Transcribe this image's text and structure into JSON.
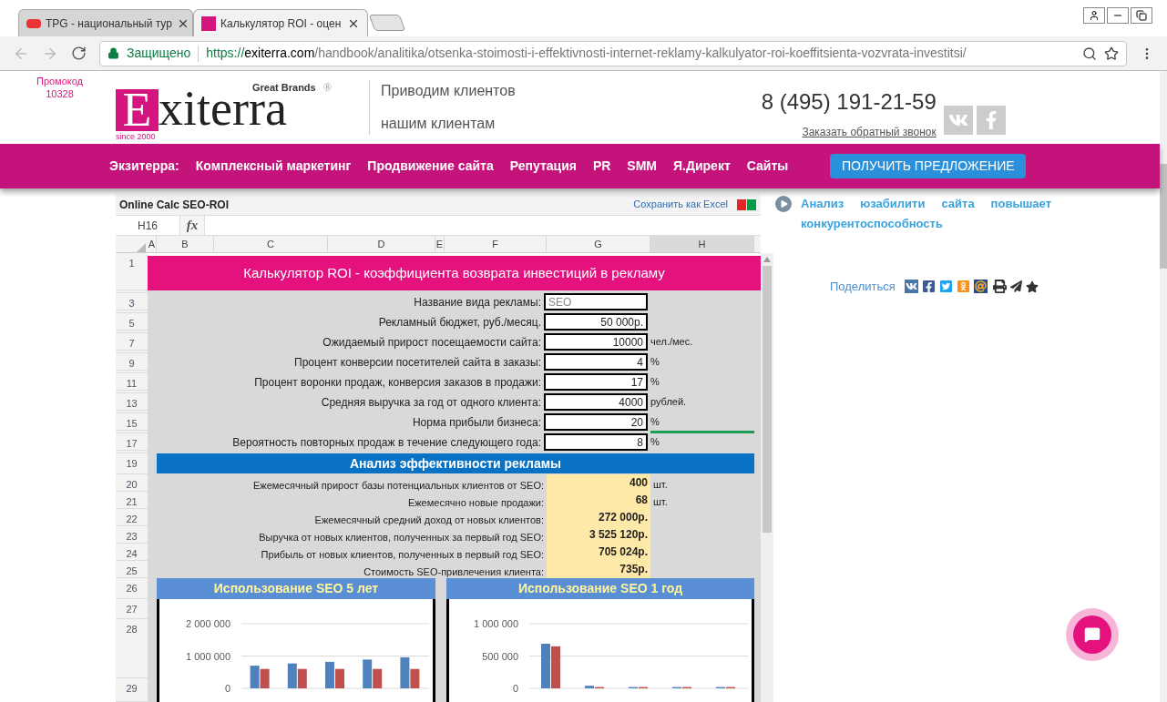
{
  "browser": {
    "tabs": [
      {
        "title": "TPG - национальный тур",
        "selected": false
      },
      {
        "title": "Калькулятор ROI - оцен",
        "selected": true
      }
    ],
    "address": {
      "secure_label": "Защищено",
      "scheme": "https://",
      "host": "exiterra.com",
      "path": "/handbook/analitika/otsenka-stoimosti-i-effektivnosti-internet-reklamy-kalkulyator-roi-koeffitsienta-vozvrata-investitsi/"
    }
  },
  "header": {
    "promo": [
      "Промокод",
      "10328"
    ],
    "logo": {
      "initial": "E",
      "rest": "xiterra",
      "brands": "Great Brands",
      "mark": "®",
      "since": "since 2000"
    },
    "slogan": [
      "Приводим клиентов",
      "нашим клиентам"
    ],
    "phone": "8 (495) 191-21-59",
    "callback": "Заказать обратный звонок"
  },
  "nav": {
    "label": "Экзитерра:",
    "items": [
      "Комплексный маркетинг",
      "Продвижение сайта",
      "Репутация",
      "PR",
      "SMM",
      "Я.Директ",
      "Сайты"
    ],
    "cta": "ПОЛУЧИТЬ ПРЕДЛОЖЕНИЕ"
  },
  "sheet": {
    "title": "Online Calc SEO-ROI",
    "save_link": "Сохранить как Excel",
    "cell_ref": "H16",
    "fx": "fx",
    "columns": [
      {
        "label": "A",
        "selected": false
      },
      {
        "label": "B",
        "selected": false
      },
      {
        "label": "C",
        "selected": false
      },
      {
        "label": "D",
        "selected": false
      },
      {
        "label": "E",
        "selected": false
      },
      {
        "label": "F",
        "selected": false
      },
      {
        "label": "G",
        "selected": false
      },
      {
        "label": "H",
        "selected": true
      }
    ],
    "title_row": {
      "row": "1",
      "text": "Калькулятор ROI - коэффициента возврата инвестиций в рекламу"
    },
    "inputs": [
      {
        "row": "3",
        "label": "Название вида рекламы:",
        "value": "SEO",
        "kind": "text",
        "active_below": false
      },
      {
        "row": "5",
        "label": "Рекламный бюджет, руб./месяц.",
        "value": "50 000р.",
        "kind": "number",
        "active_below": false
      },
      {
        "row": "7",
        "label": "Ожидаемый прирост посещаемости сайта:",
        "value": "10000",
        "unit": "чел./мес.",
        "kind": "number",
        "active_below": false
      },
      {
        "row": "9",
        "label": "Процент конверсии посетителей сайта в заказы:",
        "value": "4",
        "unit": "%",
        "kind": "number",
        "active_below": false
      },
      {
        "row": "11",
        "label": "Процент воронки продаж, конверсия заказов в продажи:",
        "value": "17",
        "unit": "%",
        "kind": "number",
        "active_below": false
      },
      {
        "row": "13",
        "label": "Средняя выручка за год от одного клиента:",
        "value": "4000",
        "unit": "рублей.",
        "kind": "number",
        "active_below": false
      },
      {
        "row": "15",
        "label": "Норма прибыли бизнеса:",
        "value": "20",
        "unit": "%",
        "kind": "number",
        "active_below": true
      },
      {
        "row": "17",
        "label": "Вероятность повторных продаж в течение следующего года:",
        "value": "8",
        "unit": "%",
        "kind": "number",
        "active_below": false
      }
    ],
    "section_row": {
      "row": "19",
      "text": "Анализ эффективности рекламы"
    },
    "results": [
      {
        "row": "20",
        "label": "Ежемесячный прирост базы потенциальных клиентов от SEO:",
        "value": "400",
        "unit": "шт."
      },
      {
        "row": "21",
        "label": "Ежемесячно новые продажи:",
        "value": "68",
        "unit": "шт."
      },
      {
        "row": "22",
        "label": "Ежемесячный средний доход от новых клиентов:",
        "value": "272 000р."
      },
      {
        "row": "23",
        "label": "Выручка от новых клиентов, полученных за первый год SEO:",
        "value": "3 525 120р."
      },
      {
        "row": "24",
        "label": "Прибыль от новых клиентов, полученных в первый год SEO:",
        "value": "705 024р."
      },
      {
        "row": "25",
        "label": "Стоимость SEO-привлечения клиента:",
        "value": "735р."
      }
    ],
    "chart_rows": [
      "26",
      "27",
      "28",
      "29"
    ],
    "charts": [
      {
        "title": "Использование SEO 5 лет",
        "chart_data": {
          "type": "bar",
          "ylim": [
            0,
            2000000
          ],
          "yticks": [
            {
              "value": 0,
              "label": "0"
            },
            {
              "value": 1000000,
              "label": "1 000 000"
            },
            {
              "value": 2000000,
              "label": "2 000 000"
            }
          ],
          "series": [
            {
              "color": "#4f81bd",
              "values": [
                700000,
                770000,
                820000,
                890000,
                960000
              ]
            },
            {
              "color": "#c0504d",
              "values": [
                600000,
                600000,
                600000,
                600000,
                600000
              ]
            }
          ]
        }
      },
      {
        "title": "Использование SEO 1 год",
        "chart_data": {
          "type": "bar",
          "ylim": [
            0,
            1000000
          ],
          "yticks": [
            {
              "value": 0,
              "label": "0"
            },
            {
              "value": 500000,
              "label": "500 000"
            },
            {
              "value": 1000000,
              "label": "1 000 000"
            }
          ],
          "series": [
            {
              "color": "#4f81bd",
              "values": [
                690000,
                40000,
                20000,
                20000,
                20000
              ]
            },
            {
              "color": "#c0504d",
              "values": [
                650000,
                20000,
                20000,
                20000,
                20000
              ]
            }
          ]
        }
      }
    ]
  },
  "aside": {
    "link": "Анализ юзабилити сайта повышает конкурентоспособность",
    "share_label": "Поделиться"
  }
}
